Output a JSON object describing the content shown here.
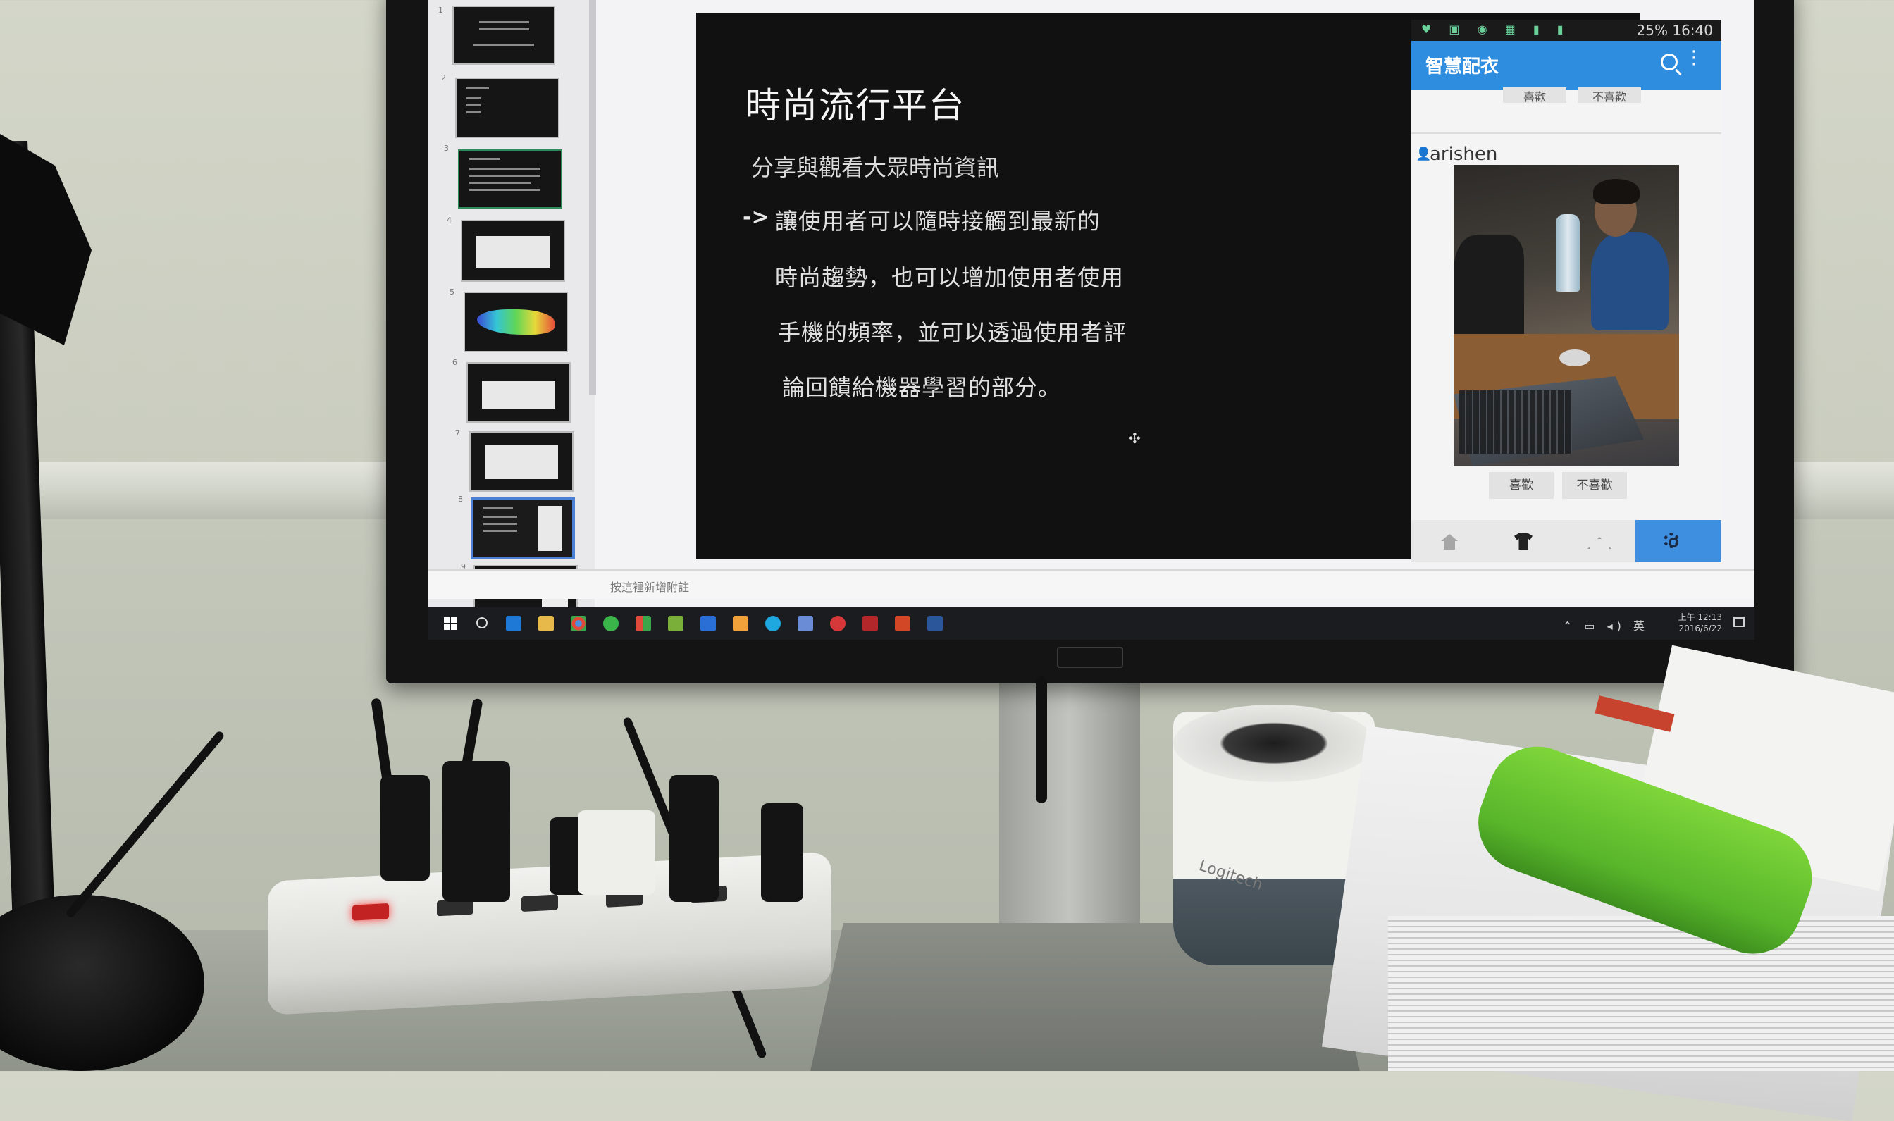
{
  "slide_thumbnails": [
    {
      "num": "1"
    },
    {
      "num": "2"
    },
    {
      "num": "3"
    },
    {
      "num": "4"
    },
    {
      "num": "5"
    },
    {
      "num": "6"
    },
    {
      "num": "7"
    },
    {
      "num": "8"
    },
    {
      "num": "9"
    }
  ],
  "slide": {
    "title": "時尚流行平台",
    "subtitle": "分享與觀看大眾時尚資訊",
    "arrow": "->",
    "lines": [
      "讓使用者可以隨時接觸到最新的",
      "時尚趨勢，也可以增加使用者使用",
      "手機的頻率，並可以透過使用者評",
      "論回饋給機器學習的部分。"
    ]
  },
  "phone": {
    "status_right": "25% 16:40",
    "app_title": "智慧配衣",
    "peek_like": "喜歡",
    "peek_dislike": "不喜歡",
    "username": "arishen",
    "like_label": "喜歡",
    "dislike_label": "不喜歡",
    "accent": "#2f8de0"
  },
  "notes_placeholder": "按這裡新增附註",
  "taskbar": {
    "time": "上午 12:13",
    "date": "2016/6/22",
    "lang": "英"
  },
  "speaker_brand": "Logitech"
}
